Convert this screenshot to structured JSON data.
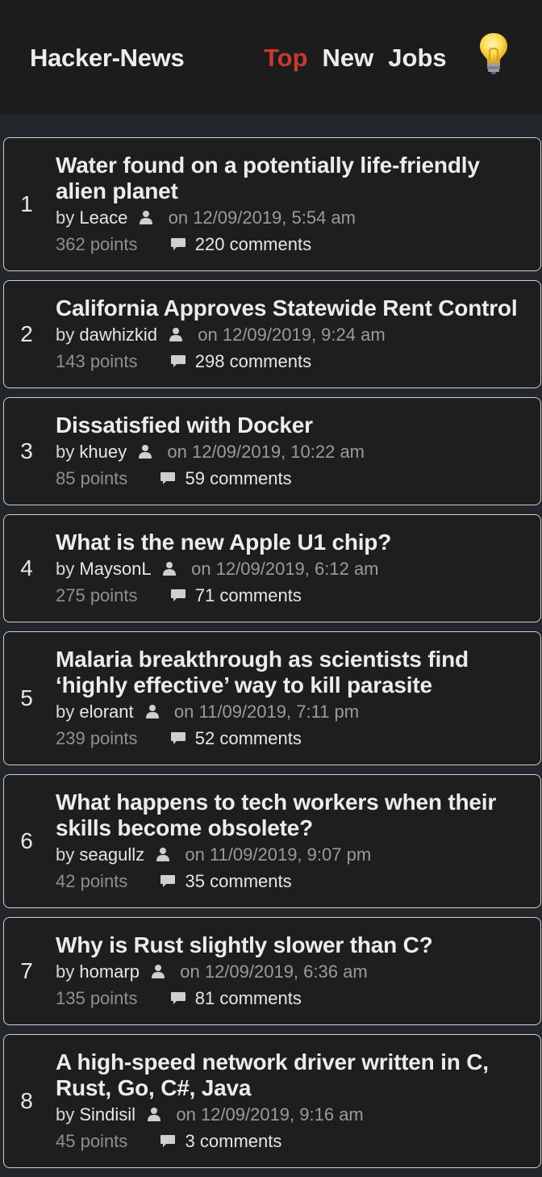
{
  "header": {
    "brand": "Hacker-News",
    "nav": [
      {
        "label": "Top",
        "active": true
      },
      {
        "label": "New",
        "active": false
      },
      {
        "label": "Jobs",
        "active": false
      }
    ],
    "theme_icon": "lightbulb-icon"
  },
  "labels": {
    "by": "by",
    "on": "on"
  },
  "colors": {
    "accent": "#c8392f",
    "card_border": "#cfcfcf",
    "background": "#23272b"
  },
  "stories": [
    {
      "rank": "1",
      "title": "Water found on a potentially life-friendly alien planet",
      "author": "Leace",
      "date": "12/09/2019, 5:54 am",
      "points": "362 points",
      "comments": "220 comments"
    },
    {
      "rank": "2",
      "title": "California Approves Statewide Rent Control",
      "author": "dawhizkid",
      "date": "12/09/2019, 9:24 am",
      "points": "143 points",
      "comments": "298 comments"
    },
    {
      "rank": "3",
      "title": "Dissatisfied with Docker",
      "author": "khuey",
      "date": "12/09/2019, 10:22 am",
      "points": "85 points",
      "comments": "59 comments"
    },
    {
      "rank": "4",
      "title": "What is the new Apple U1 chip?",
      "author": "MaysonL",
      "date": "12/09/2019, 6:12 am",
      "points": "275 points",
      "comments": "71 comments"
    },
    {
      "rank": "5",
      "title": "Malaria breakthrough as scientists find ‘highly effective’ way to kill parasite",
      "author": "elorant",
      "date": "11/09/2019, 7:11 pm",
      "points": "239 points",
      "comments": "52 comments"
    },
    {
      "rank": "6",
      "title": "What happens to tech workers when their skills become obsolete?",
      "author": "seagullz",
      "date": "11/09/2019, 9:07 pm",
      "points": "42 points",
      "comments": "35 comments"
    },
    {
      "rank": "7",
      "title": "Why is Rust slightly slower than C?",
      "author": "homarp",
      "date": "12/09/2019, 6:36 am",
      "points": "135 points",
      "comments": "81 comments"
    },
    {
      "rank": "8",
      "title": "A high-speed network driver written in C, Rust, Go, C#, Java",
      "author": "Sindisil",
      "date": "12/09/2019, 9:16 am",
      "points": "45 points",
      "comments": "3 comments"
    }
  ]
}
